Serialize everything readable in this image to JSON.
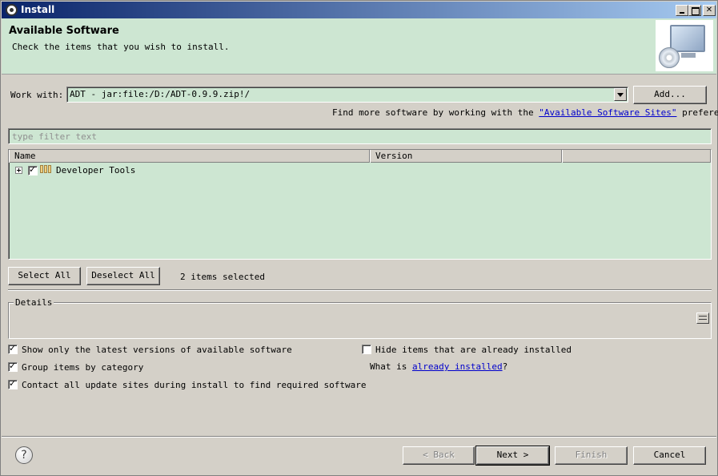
{
  "window": {
    "title": "Install"
  },
  "banner": {
    "heading": "Available Software",
    "subtitle": "Check the items that you wish to install."
  },
  "work_with": {
    "label": "Work with:",
    "value": "ADT - jar:file:/D:/ADT-0.9.9.zip!/",
    "add_button": "Add..."
  },
  "find_more": {
    "prefix": "Find more software by working with the ",
    "link": "\"Available Software Sites\"",
    "suffix": " preferences."
  },
  "filter": {
    "placeholder": "type filter text"
  },
  "table": {
    "columns": [
      "Name",
      "Version",
      ""
    ],
    "rows": [
      {
        "name": "Developer Tools",
        "version": "",
        "checked": true,
        "expandable": true
      }
    ]
  },
  "selection": {
    "select_all": "Select All",
    "deselect_all": "Deselect All",
    "status": "2 items selected"
  },
  "details": {
    "legend": "Details"
  },
  "options": {
    "show_latest": {
      "label": "Show only the latest versions of available software",
      "checked": true
    },
    "group_by_category": {
      "label": "Group items by category",
      "checked": true
    },
    "contact_sites": {
      "label": "Contact all update sites during install to find required software",
      "checked": true
    },
    "hide_installed": {
      "label": "Hide items that are already installed",
      "checked": false
    },
    "what_is_prefix": "What is ",
    "what_is_link": "already installed",
    "what_is_suffix": "?"
  },
  "footer": {
    "back": "< Back",
    "next": "Next >",
    "finish": "Finish",
    "cancel": "Cancel",
    "help_glyph": "?"
  },
  "colors": {
    "content_bg": "#cde6d2",
    "dialog_bg": "#d4d0c8",
    "title_gradient_start": "#0a246a"
  }
}
